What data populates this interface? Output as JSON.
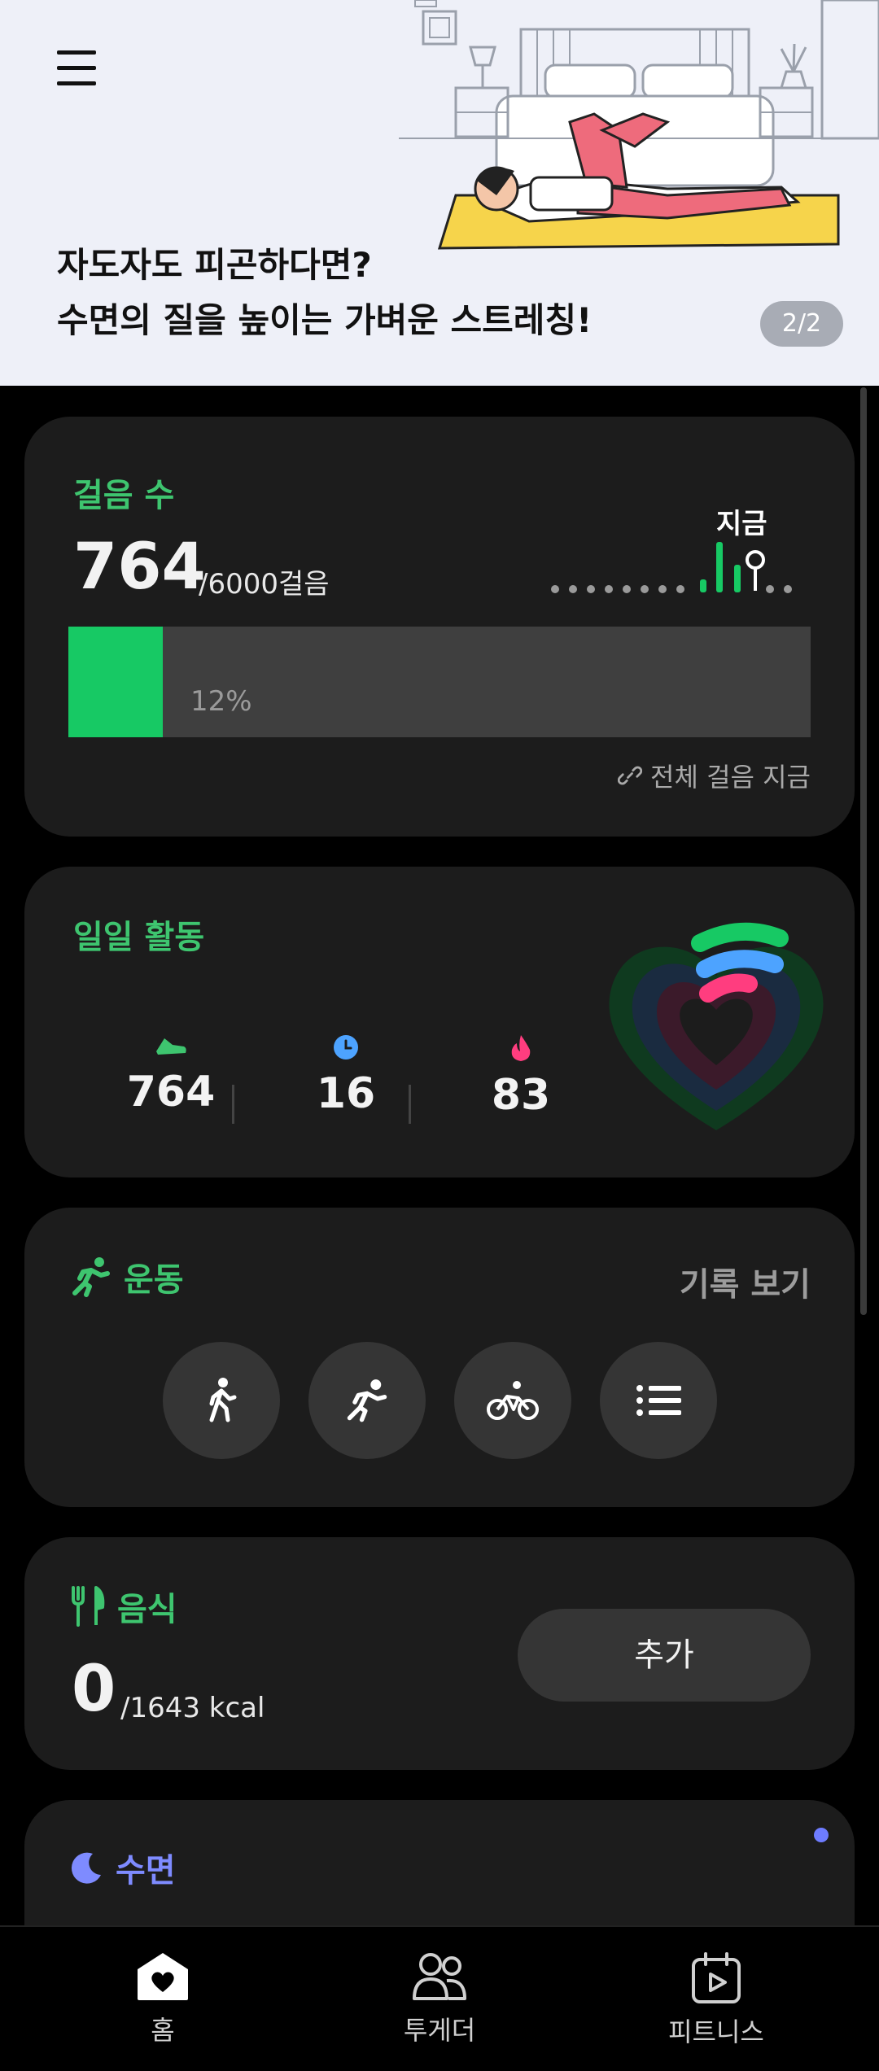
{
  "banner": {
    "title_line1": "자도자도 피곤하다면?",
    "title_line2": "수면의 질을 높이는 가벼운 스트레칭!",
    "page_indicator": "2/2",
    "menu_icon": "hamburger-menu-icon"
  },
  "steps": {
    "title": "걸음 수",
    "value": "764",
    "goal": "/6000걸음",
    "now_label": "지금",
    "progress_percent_label": "12%",
    "progress_fraction": 0.127,
    "link_label": "전체 걸음 지금",
    "link_icon": "link-icon",
    "accent_color": "#17c964"
  },
  "daily": {
    "title": "일일 활동",
    "stats": [
      {
        "value": "764",
        "icon": "shoe-icon",
        "color": "#3ec56f"
      },
      {
        "value": "16",
        "icon": "clock-icon",
        "color": "#4da3ff"
      },
      {
        "value": "83",
        "icon": "flame-icon",
        "color": "#ff3d7f"
      }
    ],
    "ring_colors": [
      "#17c964",
      "#4da3ff",
      "#ff3d7f"
    ]
  },
  "exercise": {
    "title": "운동",
    "record_link": "기록 보기",
    "buttons": [
      "walking-icon",
      "running-icon",
      "cycling-icon",
      "list-icon"
    ]
  },
  "food": {
    "title": "음식",
    "value": "0",
    "goal": "/1643 kcal",
    "add_label": "추가"
  },
  "sleep": {
    "title": "수면",
    "accent_color": "#7e8bff"
  },
  "nav": {
    "items": [
      {
        "label": "홈",
        "icon": "home-heart-icon"
      },
      {
        "label": "투게더",
        "icon": "people-icon"
      },
      {
        "label": "피트니스",
        "icon": "fitness-calendar-play-icon"
      }
    ]
  }
}
